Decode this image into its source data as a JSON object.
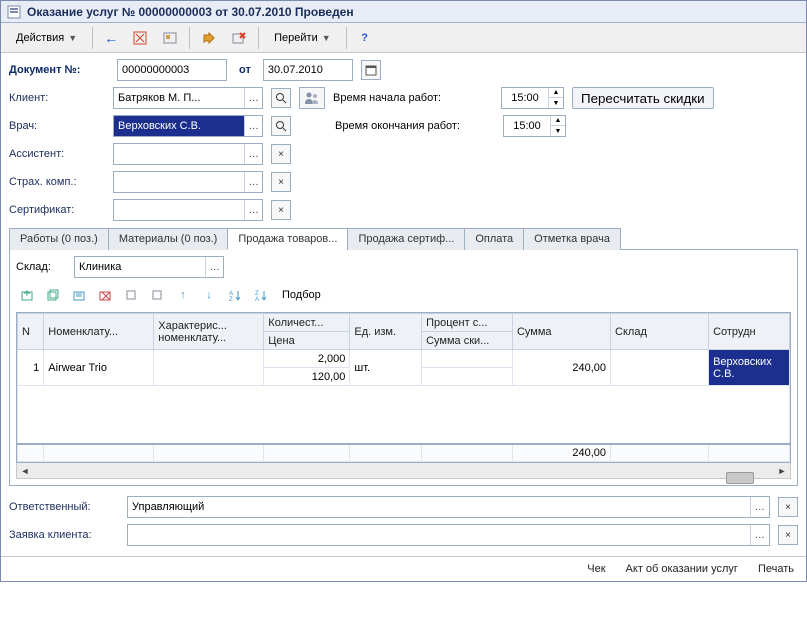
{
  "title": "Оказание услуг № 00000000003 от 30.07.2010 Проведен",
  "toolbar": {
    "actions": "Действия",
    "goto": "Перейти"
  },
  "doc": {
    "num_label": "Документ №:",
    "num": "00000000003",
    "from": "от",
    "date": "30.07.2010"
  },
  "fields": {
    "client_label": "Клиент:",
    "client": "Батряков М. П...",
    "doctor_label": "Врач:",
    "doctor": "Верховских С.В.",
    "assistant_label": "Ассистент:",
    "assistant": "",
    "ins_label": "Страх. комп.:",
    "ins": "",
    "cert_label": "Сертификат:",
    "cert": ""
  },
  "times": {
    "start_label": "Время начала работ:",
    "start": "15:00",
    "end_label": "Время окончания работ:",
    "end": "15:00"
  },
  "buttons": {
    "recalc": "Пересчитать скидки"
  },
  "tabs": {
    "t0": "Работы (0 поз.)",
    "t1": "Материалы (0 поз.)",
    "t2": "Продажа товаров...",
    "t3": "Продажа сертиф...",
    "t4": "Оплата",
    "t5": "Отметка врача"
  },
  "sklad": {
    "label": "Склад:",
    "value": "Клиника"
  },
  "podbor": "Подбор",
  "grid": {
    "headers": {
      "n": "N",
      "nomen": "Номенклату...",
      "char": "Характерис... номенклату...",
      "qty": "Количест...",
      "price": "Цена",
      "unit": "Ед. изм.",
      "discp": "Процент с...",
      "discs": "Сумма ски...",
      "sum": "Сумма",
      "sklad": "Склад",
      "emp": "Сотрудн"
    },
    "row": {
      "n": "1",
      "nomen": "Airwear Trio",
      "char": "",
      "qty": "2,000",
      "price": "120,00",
      "unit": "шт.",
      "discp": "",
      "discs": "",
      "sum": "240,00",
      "sklad": "",
      "emp": "Верховских С.В."
    },
    "total_sum": "240,00"
  },
  "bottom": {
    "resp_label": "Ответственный:",
    "resp": "Управляющий",
    "order_label": "Заявка клиента:",
    "order": ""
  },
  "footer": {
    "check": "Чек",
    "act": "Акт об оказании услуг",
    "print": "Печать"
  }
}
